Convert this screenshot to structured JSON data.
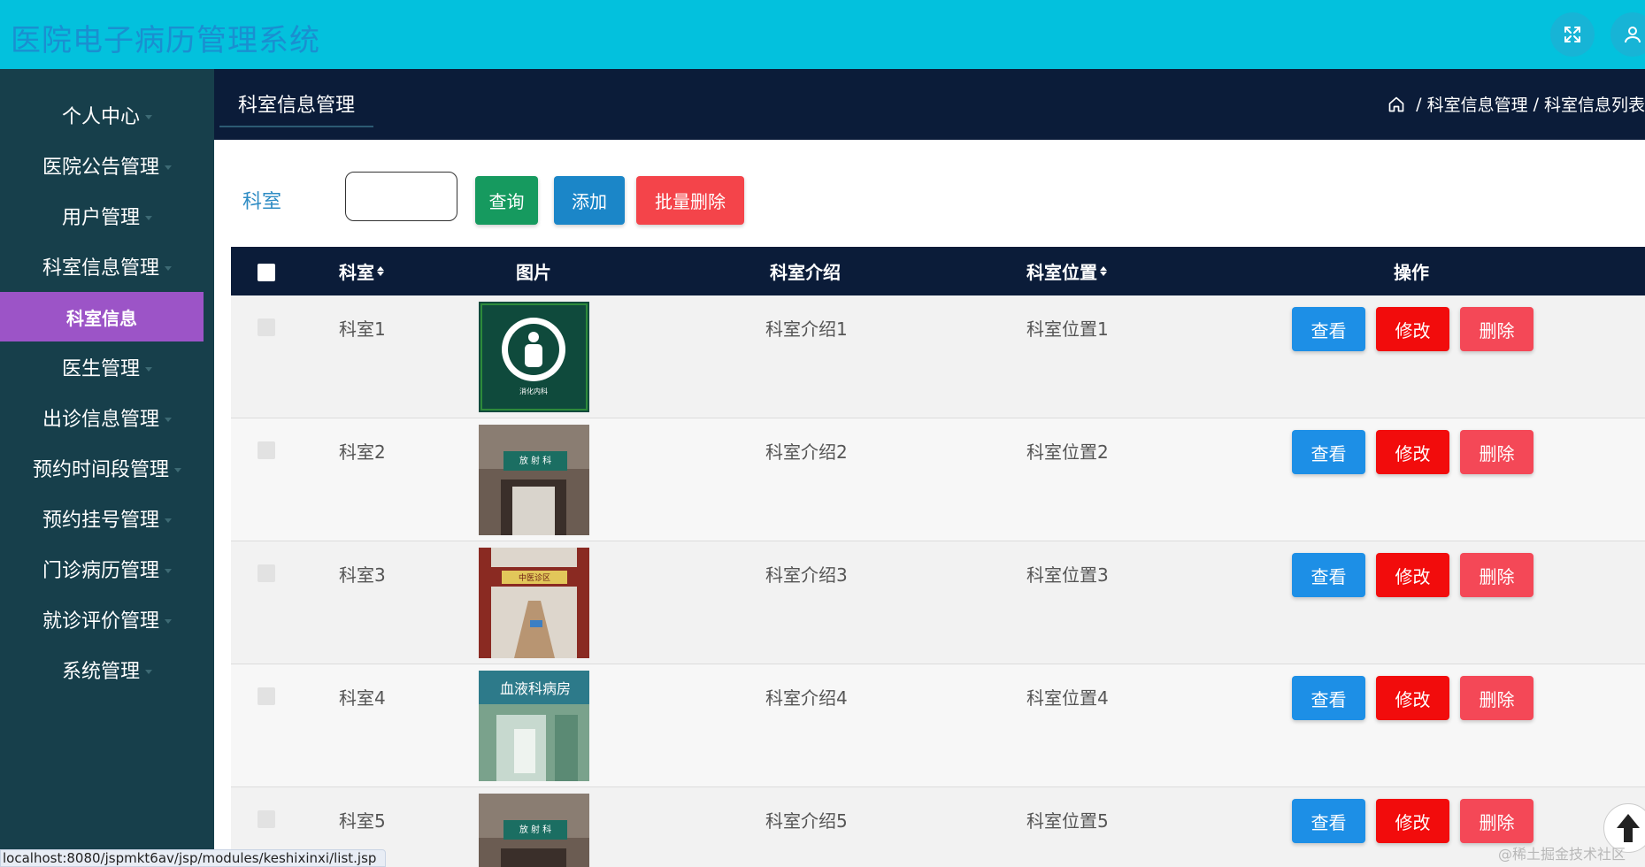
{
  "app": {
    "title": "医院电子病历管理系统"
  },
  "header": {
    "fullscreen_icon": "fullscreen-icon",
    "user_icon": "user-icon"
  },
  "sidebar": {
    "items": [
      {
        "label": "个人中心"
      },
      {
        "label": "医院公告管理"
      },
      {
        "label": "用户管理"
      },
      {
        "label": "科室信息管理"
      },
      {
        "label": "医生管理"
      },
      {
        "label": "出诊信息管理"
      },
      {
        "label": "预约时间段管理"
      },
      {
        "label": "预约挂号管理"
      },
      {
        "label": "门诊病历管理"
      },
      {
        "label": "就诊评价管理"
      },
      {
        "label": "系统管理"
      }
    ],
    "active_sub": "科室信息"
  },
  "topbar": {
    "tab": "科室信息管理",
    "breadcrumb": [
      "科室信息管理",
      "科室信息列表"
    ],
    "breadcrumb_sep": "/"
  },
  "search": {
    "label": "科室",
    "placeholder": "",
    "value": "",
    "query_button": "查询",
    "add_button": "添加",
    "batch_delete_button": "批量删除"
  },
  "table": {
    "headers": {
      "name": "科室",
      "image": "图片",
      "intro": "科室介绍",
      "location": "科室位置",
      "actions": "操作"
    },
    "action_labels": {
      "view": "查看",
      "edit": "修改",
      "delete": "删除"
    },
    "rows": [
      {
        "name": "科室1",
        "intro": "科室介绍1",
        "location": "科室位置1",
        "image_text": "消化内科"
      },
      {
        "name": "科室2",
        "intro": "科室介绍2",
        "location": "科室位置2",
        "image_text": "放 射 科"
      },
      {
        "name": "科室3",
        "intro": "科室介绍3",
        "location": "科室位置3",
        "image_text": "中医诊区"
      },
      {
        "name": "科室4",
        "intro": "科室介绍4",
        "location": "科室位置4",
        "image_text": "血液科病房"
      },
      {
        "name": "科室5",
        "intro": "科室介绍5",
        "location": "科室位置5",
        "image_text": "放 射 科"
      }
    ]
  },
  "status_bar": {
    "url": "localhost:8080/jspmkt6av/jsp/modules/keshixinxi/list.jsp"
  },
  "watermark": "@稀土掘金技术社区",
  "colors": {
    "header": "#03c1dd",
    "sidebar": "#173f4b",
    "topbar": "#0b1c39",
    "active_sub": "#9c54c7",
    "query": "#169a5f",
    "add": "#1b86c8",
    "batch_delete": "#f4444a",
    "view": "#1d8fe6",
    "edit": "#f20c0c",
    "delete": "#f44857"
  }
}
